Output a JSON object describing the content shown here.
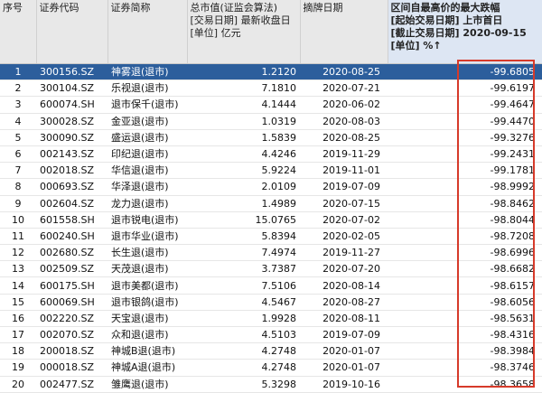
{
  "headers": {
    "index": "序号",
    "code": "证券代码",
    "name": "证券简称",
    "mktcap": [
      "总市值(证监会算法)",
      "[交易日期] 最新收盘日",
      "[单位] 亿元"
    ],
    "delist_date": "摘牌日期",
    "drop": [
      "区间自最高价的最大跌幅",
      "[起始交易日期] 上市首日",
      "[截止交易日期] 2020-09-15",
      "[单位] %↑"
    ]
  },
  "rows": [
    {
      "index": "1",
      "code": "300156.SZ",
      "name": "神雾退(退市)",
      "mktcap": "1.2120",
      "delist_date": "2020-08-25",
      "drop": "-99.6805"
    },
    {
      "index": "2",
      "code": "300104.SZ",
      "name": "乐视退(退市)",
      "mktcap": "7.1810",
      "delist_date": "2020-07-21",
      "drop": "-99.6197"
    },
    {
      "index": "3",
      "code": "600074.SH",
      "name": "退市保千(退市)",
      "mktcap": "4.1444",
      "delist_date": "2020-06-02",
      "drop": "-99.4647"
    },
    {
      "index": "4",
      "code": "300028.SZ",
      "name": "金亚退(退市)",
      "mktcap": "1.0319",
      "delist_date": "2020-08-03",
      "drop": "-99.4470"
    },
    {
      "index": "5",
      "code": "300090.SZ",
      "name": "盛运退(退市)",
      "mktcap": "1.5839",
      "delist_date": "2020-08-25",
      "drop": "-99.3276"
    },
    {
      "index": "6",
      "code": "002143.SZ",
      "name": "印纪退(退市)",
      "mktcap": "4.4246",
      "delist_date": "2019-11-29",
      "drop": "-99.2431"
    },
    {
      "index": "7",
      "code": "002018.SZ",
      "name": "华信退(退市)",
      "mktcap": "5.9224",
      "delist_date": "2019-11-01",
      "drop": "-99.1781"
    },
    {
      "index": "8",
      "code": "000693.SZ",
      "name": "华泽退(退市)",
      "mktcap": "2.0109",
      "delist_date": "2019-07-09",
      "drop": "-98.9992"
    },
    {
      "index": "9",
      "code": "002604.SZ",
      "name": "龙力退(退市)",
      "mktcap": "1.4989",
      "delist_date": "2020-07-15",
      "drop": "-98.8462"
    },
    {
      "index": "10",
      "code": "601558.SH",
      "name": "退市锐电(退市)",
      "mktcap": "15.0765",
      "delist_date": "2020-07-02",
      "drop": "-98.8044"
    },
    {
      "index": "11",
      "code": "600240.SH",
      "name": "退市华业(退市)",
      "mktcap": "5.8394",
      "delist_date": "2020-02-05",
      "drop": "-98.7208"
    },
    {
      "index": "12",
      "code": "002680.SZ",
      "name": "长生退(退市)",
      "mktcap": "7.4974",
      "delist_date": "2019-11-27",
      "drop": "-98.6996"
    },
    {
      "index": "13",
      "code": "002509.SZ",
      "name": "天茂退(退市)",
      "mktcap": "3.7387",
      "delist_date": "2020-07-20",
      "drop": "-98.6682"
    },
    {
      "index": "14",
      "code": "600175.SH",
      "name": "退市美都(退市)",
      "mktcap": "7.5106",
      "delist_date": "2020-08-14",
      "drop": "-98.6157"
    },
    {
      "index": "15",
      "code": "600069.SH",
      "name": "退市银鸽(退市)",
      "mktcap": "4.5467",
      "delist_date": "2020-08-27",
      "drop": "-98.6056"
    },
    {
      "index": "16",
      "code": "002220.SZ",
      "name": "天宝退(退市)",
      "mktcap": "1.9928",
      "delist_date": "2020-08-11",
      "drop": "-98.5631"
    },
    {
      "index": "17",
      "code": "002070.SZ",
      "name": "众和退(退市)",
      "mktcap": "4.5103",
      "delist_date": "2019-07-09",
      "drop": "-98.4316"
    },
    {
      "index": "18",
      "code": "200018.SZ",
      "name": "神城B退(退市)",
      "mktcap": "4.2748",
      "delist_date": "2020-01-07",
      "drop": "-98.3984"
    },
    {
      "index": "19",
      "code": "000018.SZ",
      "name": "神城A退(退市)",
      "mktcap": "4.2748",
      "delist_date": "2020-01-07",
      "drop": "-98.3746"
    },
    {
      "index": "20",
      "code": "002477.SZ",
      "name": "雏鹰退(退市)",
      "mktcap": "5.3298",
      "delist_date": "2019-10-16",
      "drop": "-98.3658"
    }
  ],
  "selected_row": 0,
  "colors": {
    "header_bg": "#e8e8e8",
    "selected_row": "#2c5e9c",
    "highlight_box": "#d63a2a"
  }
}
